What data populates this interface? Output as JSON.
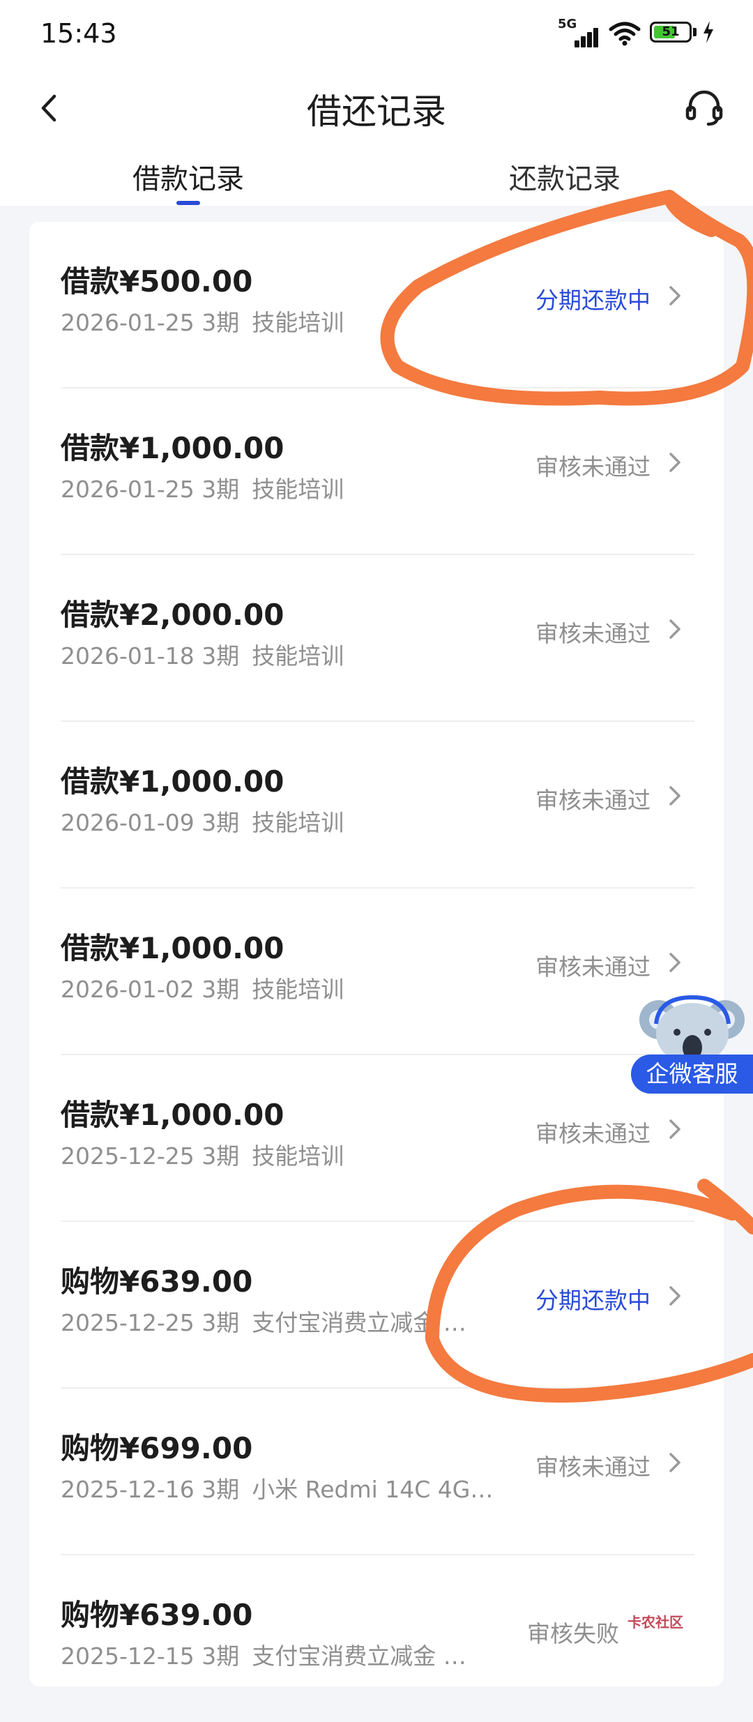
{
  "status_bar": {
    "time": "15:43",
    "network": "5G",
    "battery": "51"
  },
  "header": {
    "title": "借还记录"
  },
  "tabs": [
    {
      "label": "借款记录",
      "active": true
    },
    {
      "label": "还款记录",
      "active": false
    }
  ],
  "records": [
    {
      "amount": "借款¥500.00",
      "date": "2026-01-25",
      "term": "3期",
      "desc": "技能培训",
      "status": "分期还款中",
      "status_type": "active"
    },
    {
      "amount": "借款¥1,000.00",
      "date": "2026-01-25",
      "term": "3期",
      "desc": "技能培训",
      "status": "审核未通过",
      "status_type": "rejected"
    },
    {
      "amount": "借款¥2,000.00",
      "date": "2026-01-18",
      "term": "3期",
      "desc": "技能培训",
      "status": "审核未通过",
      "status_type": "rejected"
    },
    {
      "amount": "借款¥1,000.00",
      "date": "2026-01-09",
      "term": "3期",
      "desc": "技能培训",
      "status": "审核未通过",
      "status_type": "rejected"
    },
    {
      "amount": "借款¥1,000.00",
      "date": "2026-01-02",
      "term": "3期",
      "desc": "技能培训",
      "status": "审核未通过",
      "status_type": "rejected"
    },
    {
      "amount": "借款¥1,000.00",
      "date": "2025-12-25",
      "term": "3期",
      "desc": "技能培训",
      "status": "审核未通过",
      "status_type": "rejected"
    },
    {
      "amount": "购物¥639.00",
      "date": "2025-12-25",
      "term": "3期",
      "desc": "支付宝消费立减金 …",
      "status": "分期还款中",
      "status_type": "active"
    },
    {
      "amount": "购物¥699.00",
      "date": "2025-12-16",
      "term": "3期",
      "desc": "小米 Redmi 14C 4G…",
      "status": "审核未通过",
      "status_type": "rejected"
    },
    {
      "amount": "购物¥639.00",
      "date": "2025-12-15",
      "term": "3期",
      "desc": "支付宝消费立减金 …",
      "status": "审核失败",
      "status_type": "rejected"
    }
  ],
  "floating": {
    "kefu_label": "企微客服"
  },
  "watermark": {
    "text": "卡农社区"
  },
  "colors": {
    "accent": "#2a4bd7",
    "muted": "#8f8f8f",
    "annotation": "#f47a3f"
  }
}
